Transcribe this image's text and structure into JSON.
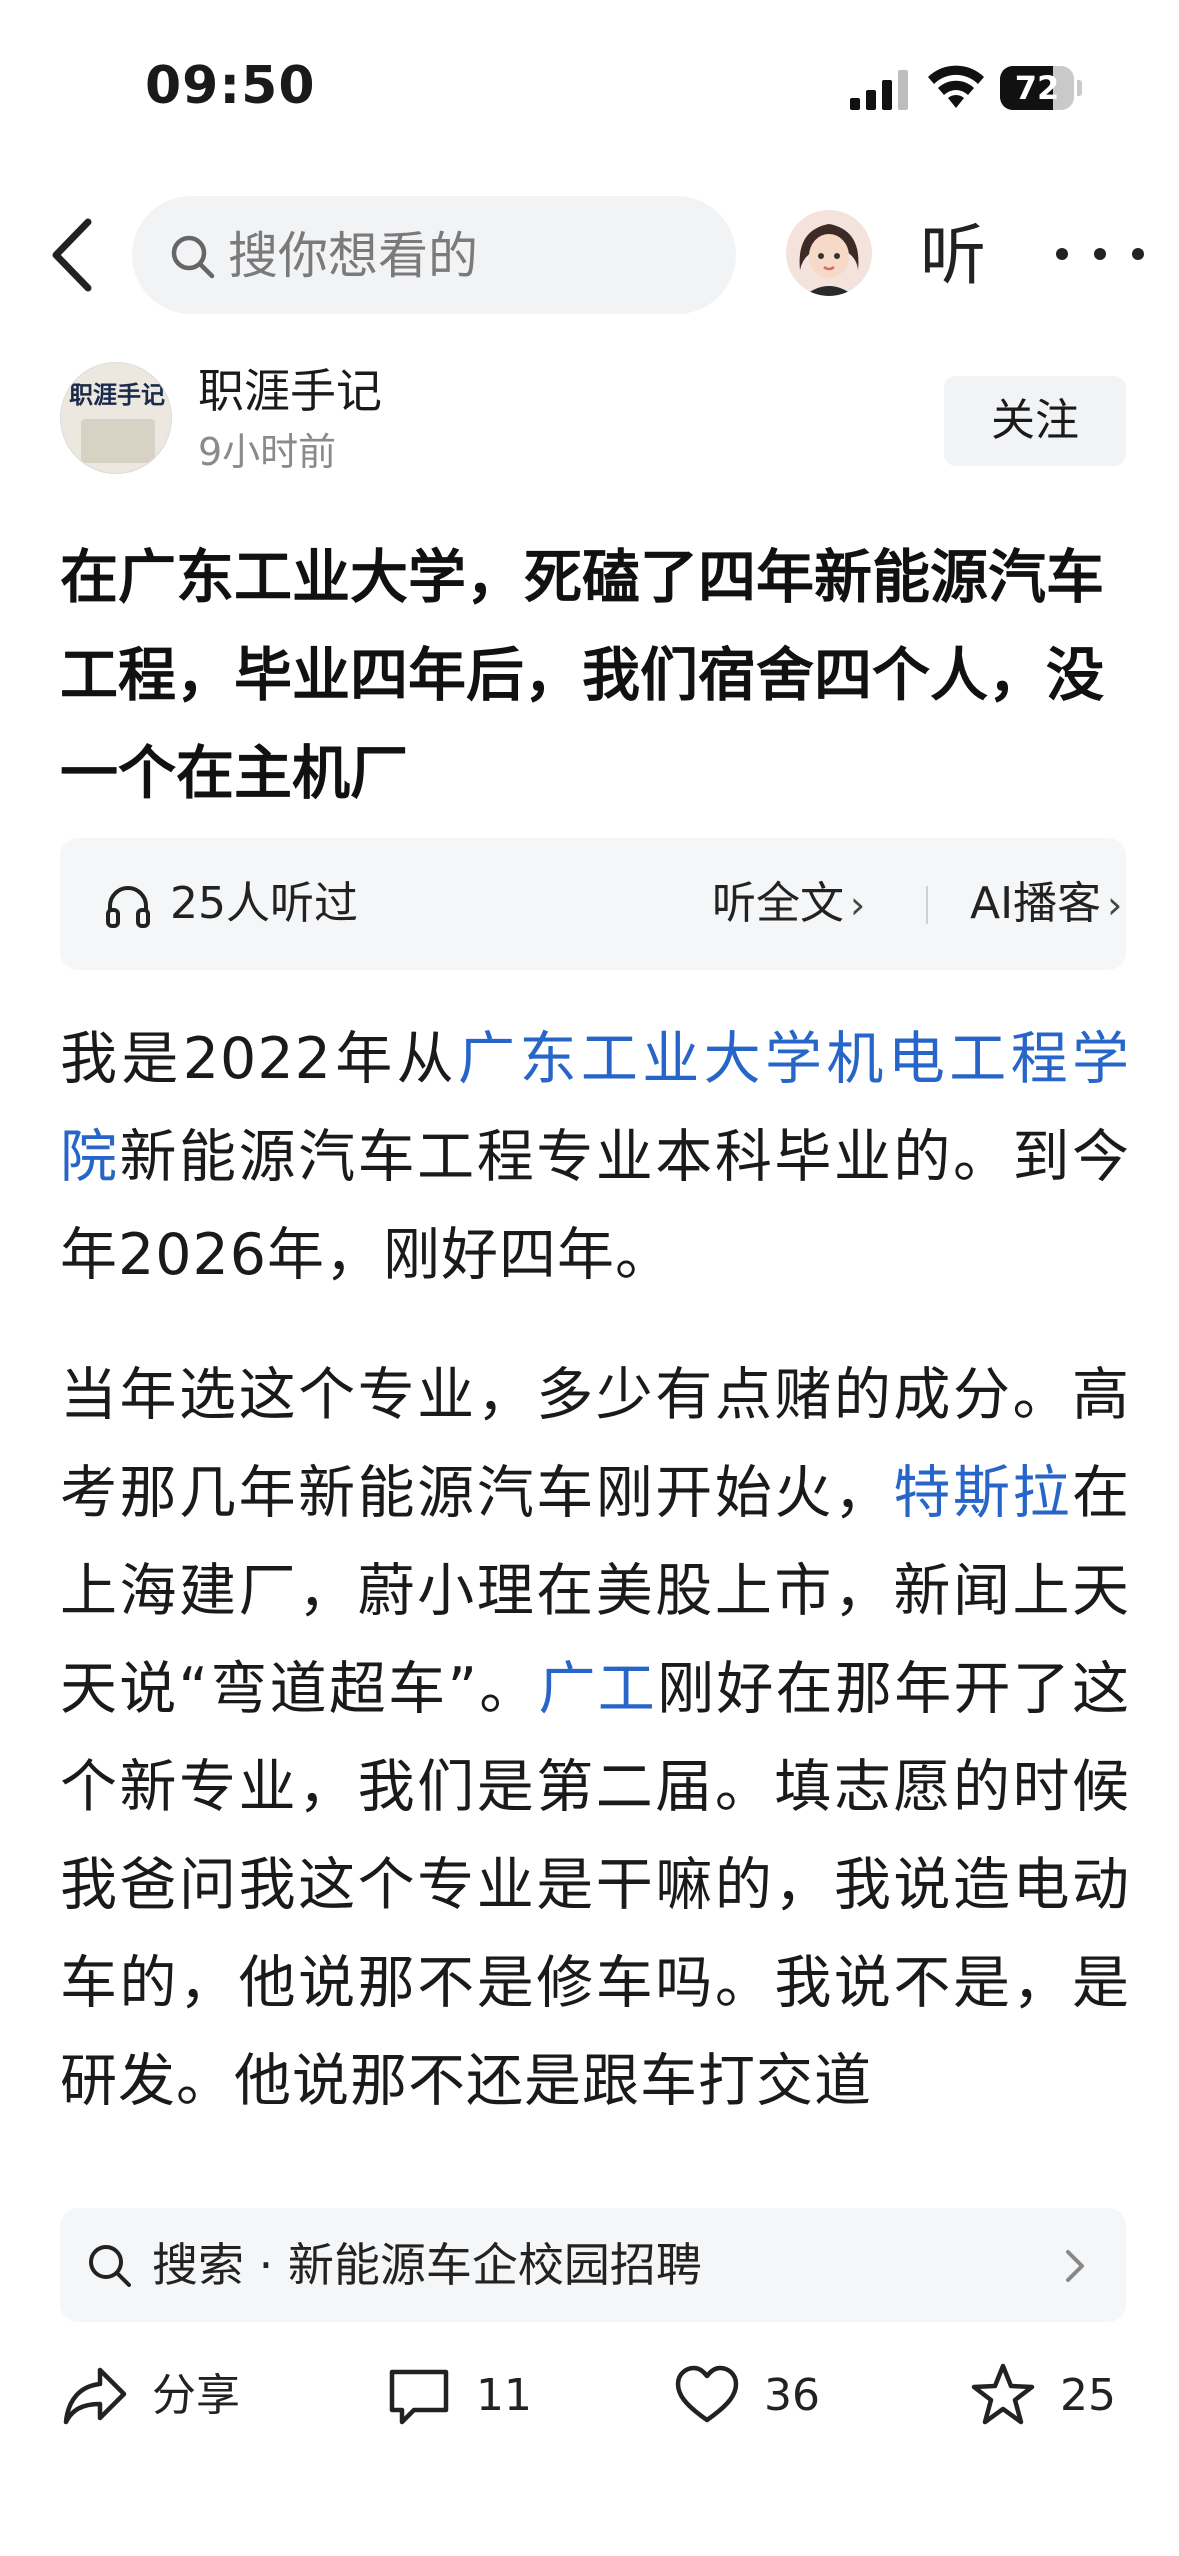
{
  "status_bar": {
    "time": "09:50",
    "battery": "72",
    "battery_level": 0.72
  },
  "nav": {
    "search_placeholder": "搜你想看的",
    "listen_label": "听"
  },
  "author": {
    "name": "职涯手记",
    "time": "9小时前",
    "follow_label": "关注",
    "avatar_text": "职涯手记"
  },
  "article": {
    "title": "在广东工业大学，死磕了四年新能源汽车工程，毕业四年后，我们宿舍四个人，没一个在主机厂",
    "listen_bar": {
      "count": "25人听过",
      "full_text": "听全文",
      "ai_podcast": "AI播客"
    },
    "para1": {
      "t1": "我是2022年从",
      "link1": "广东工业大学机电工程学院",
      "t2": "新能源汽车工程专业本科毕业的。到今年2026年，刚好四年。"
    },
    "para2": {
      "t1": "当年选这个专业，多少有点赌的成分。高考那几年新能源汽车刚开始火，",
      "link1": "特斯拉",
      "t2": "在上海建厂，蔚小理在美股上市，新闻上天天说“弯道超车”。",
      "link2": "广工",
      "t3": "刚好在那年开了这个新专业，我们是第二届。填志愿的时候我爸问我这个专业是干嘛的，我说造电动车的，他说那不是修车吗。我说不是，是研发。他说那不还是跟车打交道"
    }
  },
  "suggestion": {
    "text": "搜索 · 新能源车企校园招聘"
  },
  "actions": {
    "share": "分享",
    "comments": "11",
    "likes": "36",
    "favorites": "25"
  },
  "colors": {
    "link": "#2765c8",
    "background": "#ffffff",
    "panel": "#f5f6f7"
  }
}
